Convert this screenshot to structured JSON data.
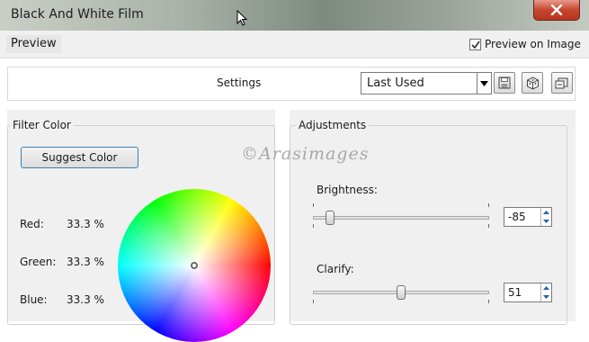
{
  "window": {
    "title": "Black And White Film"
  },
  "menubar": {
    "preview_tab": "Preview",
    "preview_on_image_label": "Preview on Image",
    "preview_on_image_checked": true
  },
  "settings": {
    "label": "Settings",
    "preset_value": "Last Used"
  },
  "filter_color": {
    "group_title": "Filter Color",
    "suggest_button": "Suggest Color",
    "red_label": "Red:",
    "red_value": "33.3 %",
    "green_label": "Green:",
    "green_value": "33.3 %",
    "blue_label": "Blue:",
    "blue_value": "33.3 %"
  },
  "adjustments": {
    "group_title": "Adjustments",
    "brightness": {
      "label": "Brightness:",
      "value": "-85",
      "level": 0.075
    },
    "clarify": {
      "label": "Clarify:",
      "value": "51",
      "level": 0.5
    }
  },
  "watermark": "©Arasimages",
  "icons": [
    "close-icon",
    "cursor-icon",
    "checkmark-icon",
    "dropdown-arrow-icon",
    "save-icon",
    "cube-icon",
    "manage-presets-icon",
    "spin-up-icon",
    "spin-down-icon"
  ]
}
